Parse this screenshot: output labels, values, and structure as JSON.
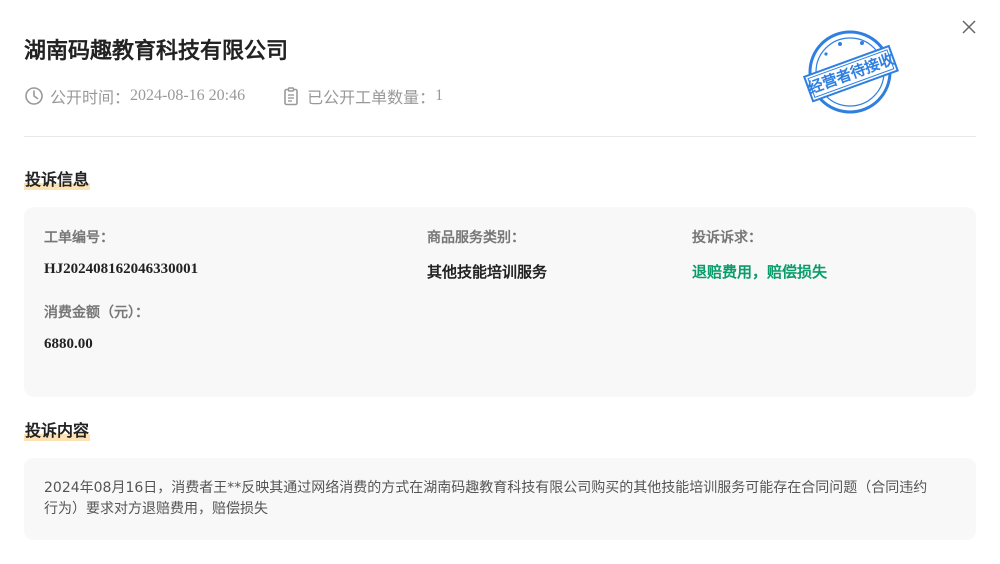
{
  "company": {
    "name": "湖南码趣教育科技有限公司"
  },
  "meta": {
    "publish_label": "公开时间：",
    "publish_time": "2024-08-16 20:46",
    "count_label": "已公开工单数量：",
    "count": "1"
  },
  "stamp": {
    "text": "经营者待接收",
    "color": "#2f7fe0"
  },
  "sections": {
    "info_title": "投诉信息",
    "content_title": "投诉内容"
  },
  "info": {
    "order_no_label": "工单编号：",
    "order_no": "HJ20240816204633​0001",
    "category_label": "商品服务类别：",
    "category": "其他技能培训服务",
    "demand_label": "投诉诉求：",
    "demand": "退赔费用，赔偿损失",
    "amount_label": "消费金额（元）：",
    "amount": "6880.00"
  },
  "content": {
    "text": "2024年08月16日，消费者王**反映其通过网络消费的方式在湖南码趣教育科技有限公司购买的其他技能培训服务可能存在合同问题（合同违约行为）要求对方退赔费用，赔偿损失"
  },
  "colors": {
    "accent_green": "#0a9d6a",
    "highlight": "#fde3b3"
  }
}
